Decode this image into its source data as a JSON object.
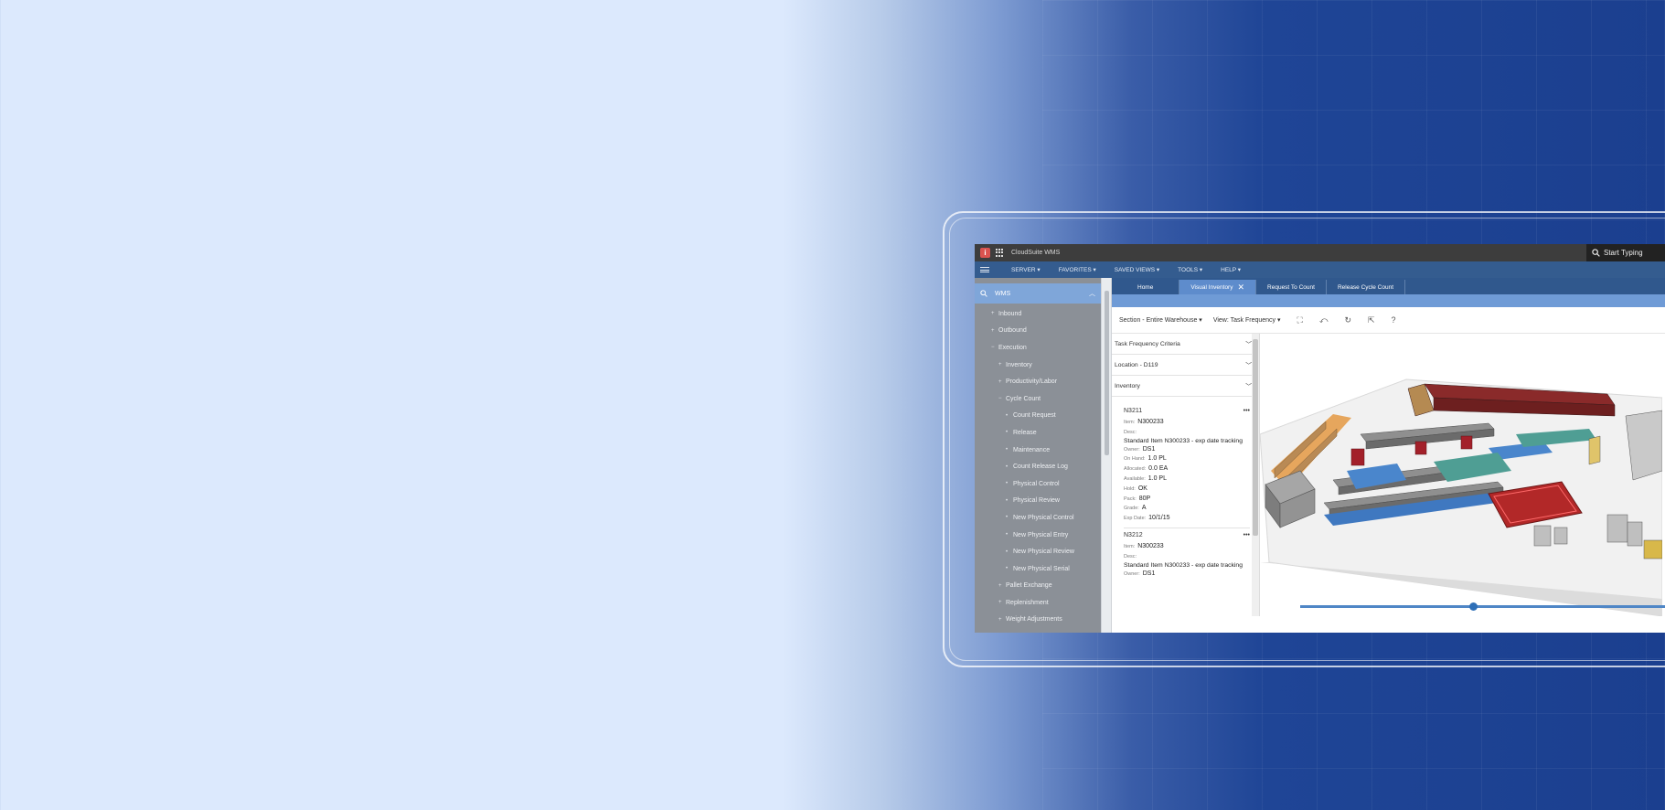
{
  "app": {
    "title": "CloudSuite WMS",
    "search_placeholder": "Start Typing"
  },
  "nav": {
    "items": [
      "SERVER ▾",
      "FAVORITES ▾",
      "SAVED VIEWS ▾",
      "TOOLS ▾",
      "HELP ▾"
    ]
  },
  "sidebar": {
    "root": "WMS",
    "items": [
      {
        "label": "Inbound",
        "level": 1,
        "marker": "+"
      },
      {
        "label": "Outbound",
        "level": 1,
        "marker": "+"
      },
      {
        "label": "Execution",
        "level": 1,
        "marker": "−"
      },
      {
        "label": "Inventory",
        "level": 2,
        "marker": "+"
      },
      {
        "label": "Productivity/Labor",
        "level": 2,
        "marker": "+"
      },
      {
        "label": "Cycle Count",
        "level": 2,
        "marker": "−"
      },
      {
        "label": "Count Request",
        "level": 3,
        "marker": "•"
      },
      {
        "label": "Release",
        "level": 3,
        "marker": "•"
      },
      {
        "label": "Maintenance",
        "level": 3,
        "marker": "•"
      },
      {
        "label": "Count Release Log",
        "level": 3,
        "marker": "•"
      },
      {
        "label": "Physical Control",
        "level": 3,
        "marker": "•"
      },
      {
        "label": "Physical Review",
        "level": 3,
        "marker": "•"
      },
      {
        "label": "New Physical Control",
        "level": 3,
        "marker": "•"
      },
      {
        "label": "New Physical Entry",
        "level": 3,
        "marker": "•"
      },
      {
        "label": "New Physical Review",
        "level": 3,
        "marker": "•"
      },
      {
        "label": "New Physical Serial",
        "level": 3,
        "marker": "•"
      },
      {
        "label": "Pallet Exchange",
        "level": 2,
        "marker": "+"
      },
      {
        "label": "Replenishment",
        "level": 2,
        "marker": "+"
      },
      {
        "label": "Weight Adjustments",
        "level": 2,
        "marker": "+"
      }
    ]
  },
  "tabs": {
    "home": "Home",
    "visual_inventory": "Visual Inventory",
    "request_to_count": "Request To Count",
    "release_cycle_count": "Release Cycle Count"
  },
  "toolbar": {
    "section": "Section - Entire Warehouse",
    "view": "View: Task Frequency"
  },
  "panel": {
    "accordions": [
      "Task Frequency Criteria",
      "Location - D119",
      "Inventory"
    ],
    "cards": [
      {
        "id": "N3211",
        "item_label": "Item:",
        "item": "N300233",
        "desc_label": "Desc:",
        "desc": "Standard Item N300233 - exp date tracking",
        "owner_label": "Owner:",
        "owner": "DS1",
        "onhand_label": "On Hand:",
        "onhand": "1.0 PL",
        "allocated_label": "Allocated:",
        "allocated": "0.0 EA",
        "available_label": "Available:",
        "available": "1.0 PL",
        "hold_label": "Hold:",
        "hold": "OK",
        "pack_label": "Pack:",
        "pack": "80P",
        "grade_label": "Grade:",
        "grade": "A",
        "expdate_label": "Exp Date:",
        "expdate": "10/1/15"
      },
      {
        "id": "N3212",
        "item_label": "Item:",
        "item": "N300233",
        "desc_label": "Desc:",
        "desc": "Standard Item N300233 - exp date tracking",
        "owner_label": "Owner:",
        "owner": "DS1"
      }
    ]
  },
  "colors": {
    "nav": "#345c8f",
    "sidebar": "#8b9097",
    "sidebar_head": "#7fa6d9",
    "active_tab": "#5e8ccc"
  }
}
